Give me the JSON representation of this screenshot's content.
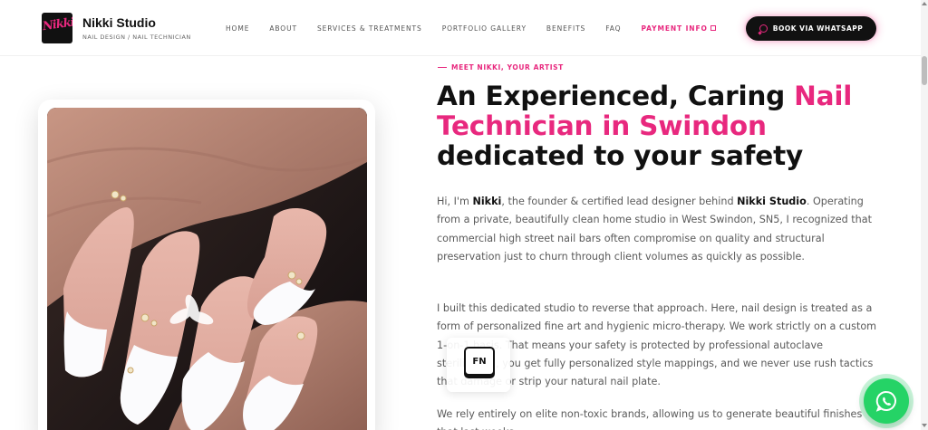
{
  "header": {
    "brand_name": "Nikki Studio",
    "brand_tagline": "NAIL DESIGN / NAIL TECHNICIAN",
    "logo_text": "Nikki",
    "nav": [
      {
        "label": "HOME"
      },
      {
        "label": "ABOUT"
      },
      {
        "label": "SERVICES & TREATMENTS"
      },
      {
        "label": "PORTFOLIO GALLERY"
      },
      {
        "label": "BENEFITS"
      },
      {
        "label": "FAQ"
      },
      {
        "label": "PAYMENT INFO"
      }
    ],
    "book_button": "BOOK VIA WHATSAPP"
  },
  "main": {
    "eyebrow": "MEET NIKKI, YOUR ARTIST",
    "headline": {
      "part1": "An Experienced, Caring ",
      "highlight": "Nail Technician in Swindon",
      "part2": " dedicated to your safety"
    },
    "para1": {
      "t1": "Hi, I'm ",
      "b1": "Nikki",
      "t2": ", the founder & certified lead designer behind ",
      "b2": "Nikki Studio",
      "t3": ". Operating from a private, beautifully clean home studio in West Swindon, SN5, I recognized that commercial high street nail bars often compromise on quality and structural preservation just to churn through client volumes as quickly as possible."
    },
    "para2": "I built this dedicated studio to reverse that approach. Here, nail design is treated as a form of personalized fine art and hygienic micro-therapy. We work strictly on a custom 1-on-1 basis. That means your safety is protected by professional autoclave sterilisation, you get fully personalized style mappings, and we never use rush tactics that damage or strip your natural nail plate.",
    "para3": "We rely entirely on elite non-toxic brands, allowing us to generate beautiful finishes that last weeks."
  },
  "overlay": {
    "fn_key": "FN"
  },
  "colors": {
    "accent": "#e8287e",
    "dark": "#111111",
    "whatsapp": "#25d366"
  }
}
